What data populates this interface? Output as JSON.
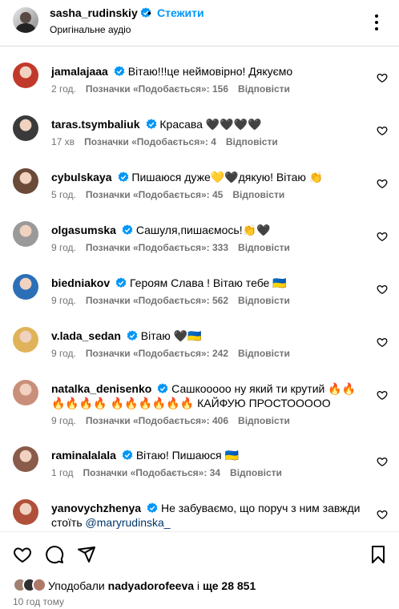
{
  "header": {
    "username": "sasha_rudinskiy",
    "separator": "•",
    "follow_label": "Стежити",
    "subtitle": "Оригінальне аудіо"
  },
  "comments": [
    {
      "username": "jamalajaaa",
      "verified": true,
      "text": "Вітаю!!!це неймовірно! Дякуємо",
      "time": "2 год.",
      "likes": "Позначки «Подобається»: 156",
      "reply": "Відповісти",
      "avatar_color": "#c0392b"
    },
    {
      "username": "taras.tsymbaliuk",
      "verified": true,
      "text": "Красава 🖤🖤🖤🖤",
      "time": "17 хв",
      "likes": "Позначки «Подобається»: 4",
      "reply": "Відповісти",
      "avatar_color": "#3a3a3a"
    },
    {
      "username": "cybulskaya",
      "verified": true,
      "text": "Пишаюся дуже💛🖤дякую! Вітаю 👏",
      "time": "5 год.",
      "likes": "Позначки «Подобається»: 45",
      "reply": "Відповісти",
      "avatar_color": "#6b4a3a"
    },
    {
      "username": "olgasumska",
      "verified": true,
      "text": "Сашуля,пишаємось!👏🖤",
      "time": "9 год.",
      "likes": "Позначки «Подобається»: 333",
      "reply": "Відповісти",
      "avatar_color": "#9a9a9a"
    },
    {
      "username": "biedniakov",
      "verified": true,
      "text": "Героям Слава ! Вітаю тебе 🇺🇦",
      "time": "9 год.",
      "likes": "Позначки «Подобається»: 562",
      "reply": "Відповісти",
      "avatar_color": "#2d6fb7"
    },
    {
      "username": "v.lada_sedan",
      "verified": true,
      "text": "Вітаю 🖤🇺🇦",
      "time": "9 год.",
      "likes": "Позначки «Подобається»: 242",
      "reply": "Відповісти",
      "avatar_color": "#e0b35a"
    },
    {
      "username": "natalka_denisenko",
      "verified": true,
      "text": "Сашкооооо ну який ти крутий 🔥🔥🔥🔥🔥🔥 🔥🔥🔥🔥🔥🔥 КАЙФУЮ ПРОСТООООО",
      "time": "9 год.",
      "likes": "Позначки «Подобається»: 406",
      "reply": "Відповісти",
      "avatar_color": "#c98f7a"
    },
    {
      "username": "raminalalala",
      "verified": true,
      "text": "Вітаю! Пишаюся 🇺🇦",
      "time": "1 год",
      "likes": "Позначки «Подобається»: 34",
      "reply": "Відповісти",
      "avatar_color": "#8a5a4a"
    },
    {
      "username": "yanovychzhenya",
      "verified": true,
      "text": "Не забуваємо, що поруч з ним завжди стоїть",
      "mention": "@maryrudinska_",
      "time": "",
      "likes": "",
      "reply": "",
      "avatar_color": "#b0503a"
    }
  ],
  "footer": {
    "liked_prefix": "Уподобали",
    "liked_user": "nadyadorofeeva",
    "liked_mid": "і",
    "liked_more": "ще 28 851",
    "time_ago": "10 год тому"
  },
  "colors": {
    "verified": "#0095f6",
    "follow": "#0095f6",
    "meta": "#737373"
  }
}
